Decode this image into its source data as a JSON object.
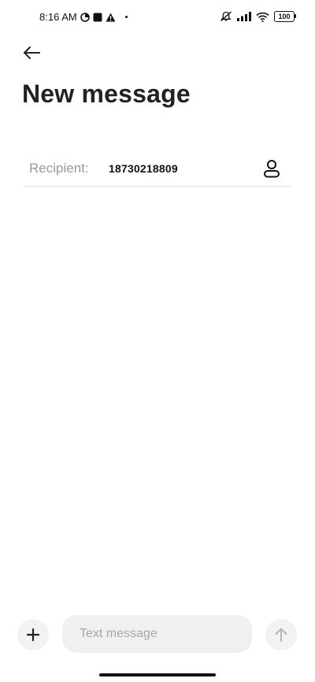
{
  "status_bar": {
    "time": "8:16 AM",
    "battery": "100",
    "icons": [
      "alarm-icon",
      "stop-icon",
      "warning-icon",
      "mute-icon",
      "signal-icon",
      "wifi-icon",
      "battery-icon"
    ]
  },
  "header": {
    "back_icon": "arrow-left-icon",
    "title": "New message"
  },
  "recipient": {
    "label": "Recipient:",
    "value": "18730218809",
    "contact_icon": "person-icon"
  },
  "composer": {
    "attach_icon": "plus-icon",
    "placeholder": "Text message",
    "value": "",
    "send_icon": "arrow-up-icon"
  }
}
